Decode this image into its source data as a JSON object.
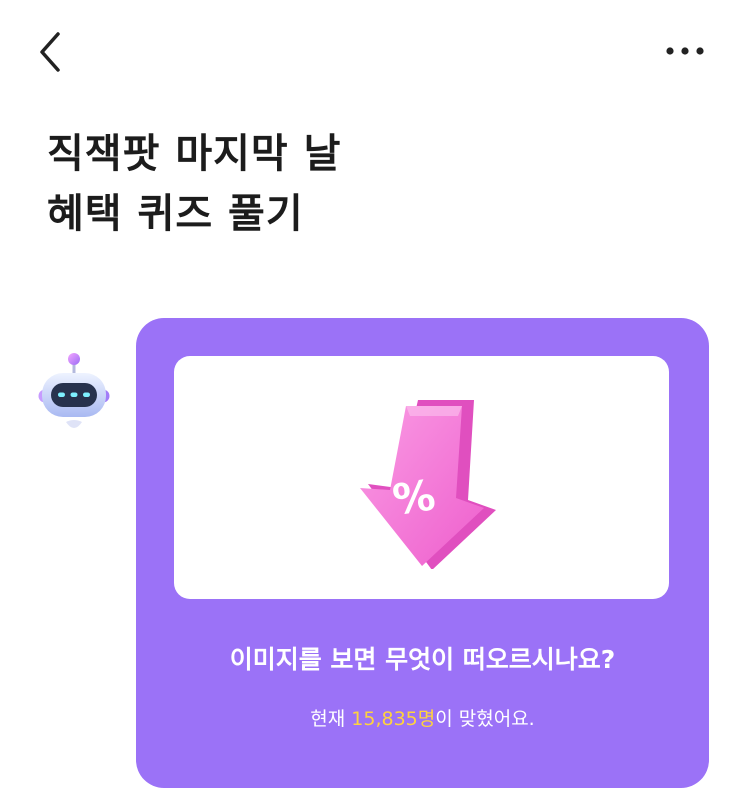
{
  "header": {
    "back_icon": "chevron-left-icon",
    "more_icon": "more-horizontal-icon"
  },
  "title": {
    "line1": "직잭팟 마지막 날",
    "line2": "혜택 퀴즈 풀기"
  },
  "bot": {
    "icon": "robot-avatar-icon"
  },
  "quiz_card": {
    "image_icon": "percent-down-arrow-icon",
    "question": "이미지를 보면 무엇이 떠오르시나요?",
    "status_prefix": "현재 ",
    "count": "15,835명",
    "status_suffix": "이 맞혔어요."
  },
  "colors": {
    "card_background": "#9b72f7",
    "count_highlight": "#ffd33d",
    "arrow": "#f57fd6"
  }
}
